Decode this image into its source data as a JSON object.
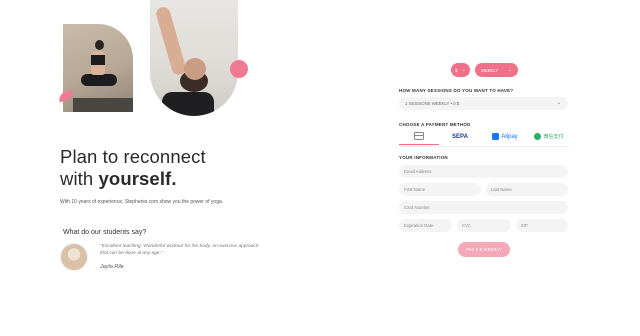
{
  "hero": {
    "headline_line1": "Plan to reconnect",
    "headline_line2_prefix": "with ",
    "headline_line2_bold": "yourself.",
    "subtext": "With 10 years of experience, Stephenie.com show you the power of yoga.",
    "students_title": "What do our students say?",
    "testimonial": {
      "quote": "\"Excellent teaching. Wonderful workout for the body. An exercise approach that can be done at any age.\"",
      "author": "Jayla Rile"
    }
  },
  "form": {
    "currency": {
      "value": "$"
    },
    "frequency": {
      "value": "WEEKLY"
    },
    "sessions_label": "HOW MANY SESSIONS DO YOU WANT TO HAVE?",
    "sessions_select": "1 SESSIONS WEEKLY • 0 $",
    "payment_label": "CHOOSE A PAYMENT METHOD",
    "payment_methods": {
      "sepa": "SEPA",
      "alipay": "Alipay",
      "wechat": "微信支付"
    },
    "info_label": "YOUR INFORMATION",
    "placeholders": {
      "email": "Email Address",
      "first_name": "First Name",
      "last_name": "Last Name",
      "card_number": "Card Number",
      "expiration": "Expiration Date",
      "cvc": "CVC",
      "zip": "ZIP"
    },
    "submit_label": "PAY 0 $ WEEKLY"
  },
  "colors": {
    "accent": "#ee7089",
    "accent_light": "#f5a9b8",
    "field_bg": "#f4f4f5"
  }
}
